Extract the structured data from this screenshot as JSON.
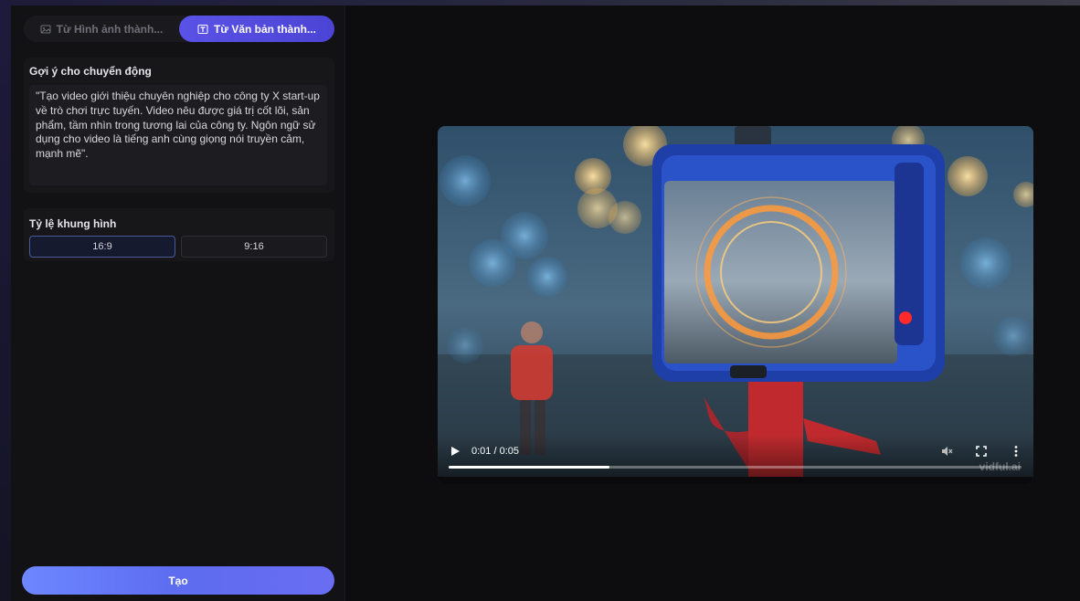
{
  "tabs": [
    {
      "label": "Từ Hình ảnh thành...",
      "icon": "image-icon",
      "active": false
    },
    {
      "label": "Từ Văn bản thành...",
      "icon": "text-frame-icon",
      "active": true
    }
  ],
  "prompt_section": {
    "title": "Gợi ý cho chuyển động",
    "text": "\"Tạo video giới thiệu chuyên nghiệp cho công ty X start-up về trò chơi trực tuyến. Video nêu được giá trị cốt lõi, sản phẩm, tầm nhìn trong tương lai của công ty. Ngôn ngữ sử dụng cho video là tiếng anh cùng giọng nói truyền cảm, mạnh mẽ\"."
  },
  "ratio_section": {
    "title": "Tỷ lệ khung hình",
    "options": [
      {
        "label": "16:9",
        "selected": true
      },
      {
        "label": "9:16",
        "selected": false
      }
    ]
  },
  "create_button": {
    "label": "Tạo"
  },
  "video_player": {
    "time": "0:01 / 0:05",
    "progress": 0.28,
    "watermark": "vidful.ai",
    "controls": [
      "play-icon",
      "mute-icon",
      "fullscreen-icon",
      "more-options-icon"
    ]
  },
  "colors": {
    "accent": "#4b44d4",
    "create_button": "#6d87ff",
    "background": "#0b0b0d"
  }
}
